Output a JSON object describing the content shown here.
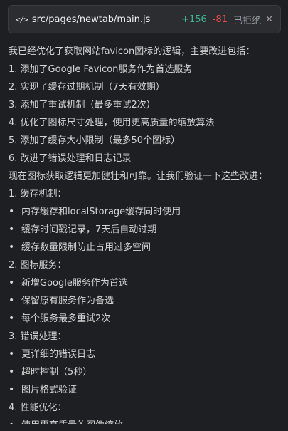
{
  "file_chip": {
    "icon": "code-icon",
    "icon_glyph": "</>",
    "path": "src/pages/newtab/main.js",
    "added": "+156",
    "removed": "-81",
    "status": "已拒绝",
    "close_glyph": "✕"
  },
  "message": {
    "intro": "我已经优化了获取网站favicon图标的逻辑，主要改进包括：",
    "improvements": [
      "1. 添加了Google Favicon服务作为首选服务",
      "2. 实现了缓存过期机制（7天有效期）",
      "3. 添加了重试机制（最多重试2次）",
      "4. 优化了图标尺寸处理，使用更高质量的缩放算法",
      "5. 添加了缓存大小限制（最多50个图标）",
      "6. 改进了错误处理和日志记录"
    ],
    "verify": "现在图标获取逻辑更加健壮和可靠。让我们验证一下这些改进：",
    "sections": [
      {
        "title": "1. 缓存机制：",
        "bullets": [
          "内存缓存和localStorage缓存同时使用",
          "缓存时间戳记录，7天后自动过期",
          "缓存数量限制防止占用过多空间"
        ]
      },
      {
        "title": "2. 图标服务：",
        "bullets": [
          "新增Google服务作为首选",
          "保留原有服务作为备选",
          "每个服务最多重试2次"
        ]
      },
      {
        "title": "3. 错误处理：",
        "bullets": [
          "更详细的错误日志",
          "超时控制（5秒）",
          "图片格式验证"
        ]
      },
      {
        "title": "4. 性能优化：",
        "bullets": [
          "使用更高质量的图像缩放"
        ]
      }
    ],
    "bullet_glyph": "•"
  }
}
